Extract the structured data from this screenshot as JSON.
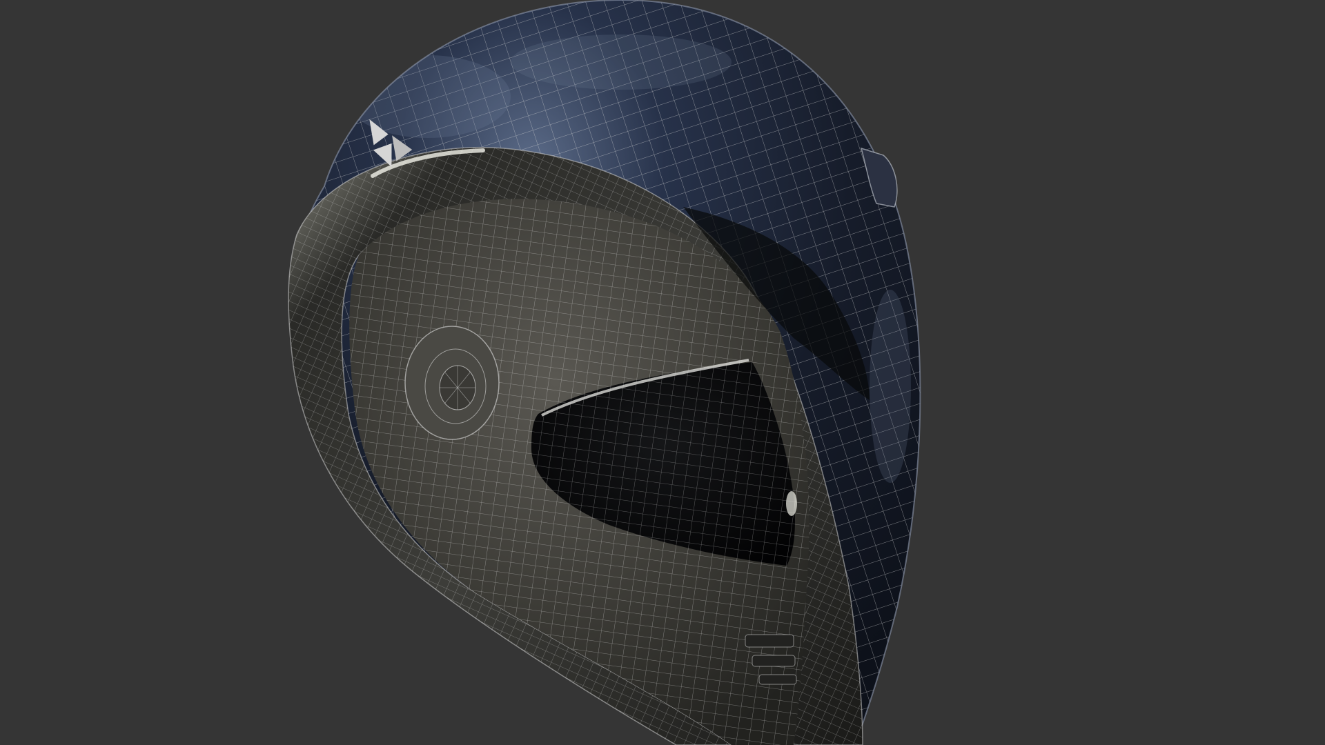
{
  "viewport": {
    "background": "#353535",
    "subject": "helmet-model",
    "display_mode": "wireframe-on-shaded"
  },
  "model": {
    "shell_color": "#1b2233",
    "shell_highlight": "#4a5a78",
    "liner_color": "#3c3b37",
    "trim_color": "#2e2e2b",
    "visor_color": "#050607",
    "wire_color": "#dcdcdc",
    "logo_color": "#d6d6d6",
    "logo_icon": "triangle-logo-icon"
  }
}
